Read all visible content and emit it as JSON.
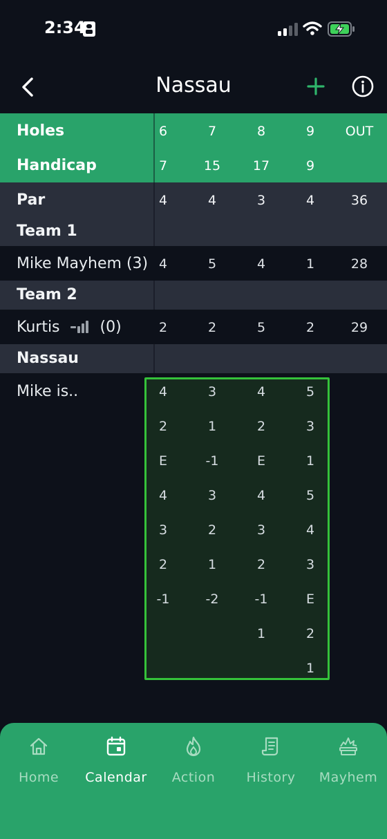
{
  "status_bar": {
    "time": "2:34"
  },
  "nav": {
    "title": "Nassau"
  },
  "scorecard": {
    "columns": [
      "6",
      "7",
      "8",
      "9",
      "OUT"
    ],
    "holes_label": "Holes",
    "handicap_label": "Handicap",
    "handicap": [
      "7",
      "15",
      "17",
      "9",
      ""
    ],
    "par_label": "Par",
    "par": [
      "4",
      "4",
      "3",
      "4",
      "36"
    ],
    "team1_label": "Team 1",
    "team1_players": [
      {
        "name": "Mike Mayhem (3)",
        "scores": [
          "4",
          "5",
          "4",
          "1",
          "28"
        ]
      }
    ],
    "team2_label": "Team 2",
    "team2_players": [
      {
        "name_prefix": "Kurtis",
        "name_suffix": "(0)",
        "scores": [
          "2",
          "2",
          "5",
          "2",
          "29"
        ]
      }
    ],
    "nassau_label": "Nassau",
    "nassau_row_label": "Mike is..",
    "nassau_rows": [
      [
        "4",
        "3",
        "4",
        "5"
      ],
      [
        "2",
        "1",
        "2",
        "3"
      ],
      [
        "E",
        "-1",
        "E",
        "1"
      ],
      [
        "4",
        "3",
        "4",
        "5"
      ],
      [
        "3",
        "2",
        "3",
        "4"
      ],
      [
        "2",
        "1",
        "2",
        "3"
      ],
      [
        "-1",
        "-2",
        "-1",
        "E"
      ],
      [
        "",
        "",
        "1",
        "2"
      ],
      [
        "",
        "",
        "",
        "1"
      ]
    ]
  },
  "tabs": [
    {
      "label": "Home",
      "icon": "home-icon",
      "active": false
    },
    {
      "label": "Calendar",
      "icon": "calendar-icon",
      "active": true
    },
    {
      "label": "Action",
      "icon": "flame-icon",
      "active": false
    },
    {
      "label": "History",
      "icon": "receipt-icon",
      "active": false
    },
    {
      "label": "Mayhem",
      "icon": "explosion-icon",
      "active": false
    }
  ],
  "colors": {
    "accent": "#29a36a",
    "highlight_border": "#35c23a",
    "background": "#0d111a",
    "section_band": "#2a2f3b"
  }
}
